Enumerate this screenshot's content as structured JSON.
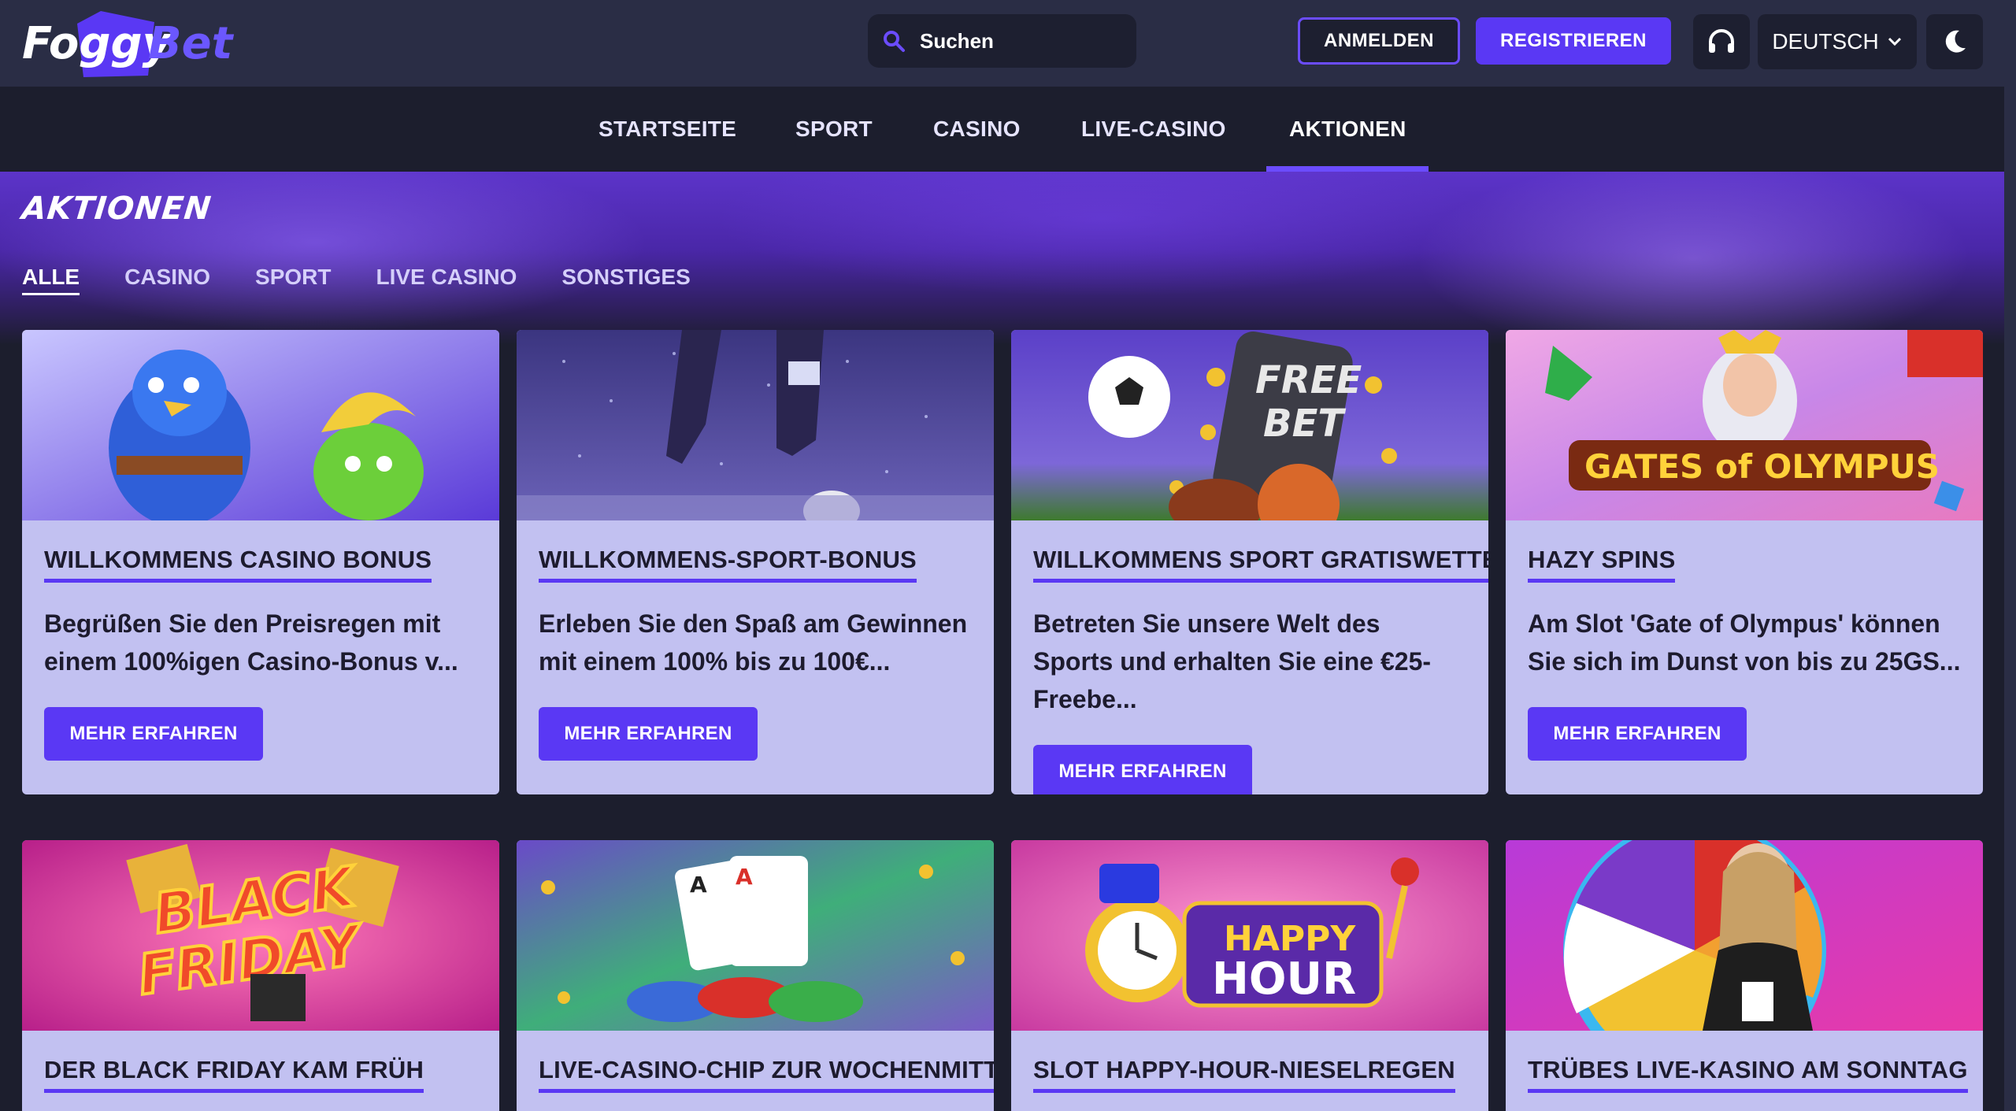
{
  "brand": {
    "name_part1": "Foggy",
    "name_part2": "Bet"
  },
  "header": {
    "search_placeholder": "Suchen",
    "login_label": "ANMELDEN",
    "register_label": "REGISTRIEREN",
    "language": "DEUTSCH",
    "icons": {
      "search": "search-icon",
      "support": "headset-icon",
      "theme": "moon-icon",
      "lang": "chevron-down-icon"
    }
  },
  "nav": {
    "items": [
      {
        "label": "STARTSEITE"
      },
      {
        "label": "SPORT"
      },
      {
        "label": "CASINO"
      },
      {
        "label": "LIVE-CASINO"
      },
      {
        "label": "AKTIONEN"
      }
    ],
    "active": "AKTIONEN"
  },
  "page": {
    "title": "AKTIONEN",
    "filters": [
      {
        "label": "ALLE"
      },
      {
        "label": "CASINO"
      },
      {
        "label": "SPORT"
      },
      {
        "label": "LIVE CASINO"
      },
      {
        "label": "SONSTIGES"
      }
    ],
    "active_filter": "ALLE"
  },
  "promotions": [
    {
      "title": "WILLKOMMENS CASINO BONUS",
      "desc": "Begrüßen Sie den Preisregen mit einem 100%igen Casino-Bonus v...",
      "cta": "MEHR ERFAHREN",
      "image": "casino-birds-art"
    },
    {
      "title": "WILLKOMMENS-SPORT-BONUS",
      "desc": "Erleben Sie den Spaß am Gewinnen mit einem 100% bis zu 100€...",
      "cta": "MEHR ERFAHREN",
      "image": "football-player-art"
    },
    {
      "title": "WILLKOMMENS SPORT GRATISWETTE",
      "desc": "Betreten Sie unsere Welt des Sports und erhalten Sie eine €25-Freebe...",
      "cta": "MEHR ERFAHREN",
      "image": "free-bet-art",
      "image_text": [
        "FREE",
        "BET"
      ]
    },
    {
      "title": "HAZY SPINS",
      "desc": "Am Slot 'Gate of Olympus' können Sie sich im Dunst von bis zu 25GS...",
      "cta": "MEHR ERFAHREN",
      "image": "gates-of-olympus-art",
      "image_text": [
        "GATES of OLYMPUS"
      ]
    },
    {
      "title": "DER BLACK FRIDAY KAM FRÜH",
      "image": "black-friday-art",
      "image_text": [
        "BLACK",
        "FRIDAY"
      ]
    },
    {
      "title": "LIVE-CASINO-CHIP ZUR WOCHENMITTE",
      "image": "casino-chips-art"
    },
    {
      "title": "SLOT HAPPY-HOUR-NIESELREGEN",
      "image": "happy-hour-art",
      "image_text": [
        "HAPPY",
        "HOUR"
      ]
    },
    {
      "title": "TRÜBES LIVE-KASINO AM SONNTAG",
      "image": "live-dealer-wheel-art"
    }
  ],
  "colors": {
    "accent": "#5a38f4",
    "card_bg": "#c2c1f1",
    "header_bg": "#2a2d45",
    "page_bg": "#1c1e2d"
  }
}
